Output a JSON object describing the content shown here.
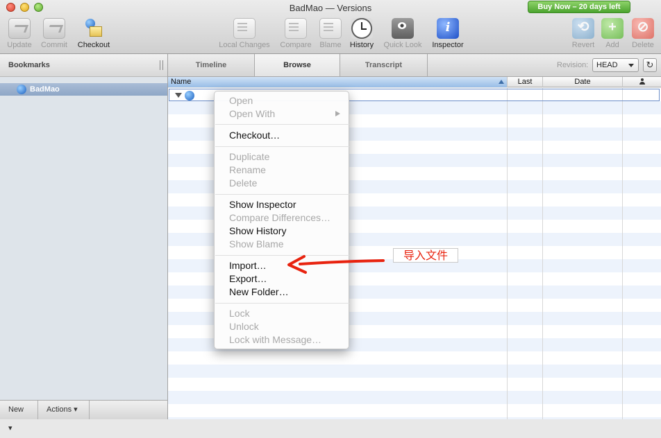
{
  "window": {
    "title": "BadMao — Versions",
    "buy_now": "Buy Now – 20 days left"
  },
  "toolbar": {
    "update": "Update",
    "commit": "Commit",
    "checkout": "Checkout",
    "local_changes": "Local Changes",
    "compare": "Compare",
    "blame": "Blame",
    "history": "History",
    "quick_look": "Quick Look",
    "inspector": "Inspector",
    "revert": "Revert",
    "add": "Add",
    "delete": "Delete"
  },
  "sidebar": {
    "header": "Bookmarks",
    "items": [
      {
        "label": "BadMao"
      }
    ],
    "footer": {
      "new_label": "New ▾",
      "actions_label": "Actions ▾"
    }
  },
  "tabs": [
    "Timeline",
    "Browse",
    "Transcript"
  ],
  "active_tab": "Browse",
  "revision": {
    "label": "Revision:",
    "value": "HEAD"
  },
  "columns": {
    "name": "Name",
    "last": "Last",
    "date": "Date"
  },
  "context_menu": {
    "open": "Open",
    "open_with": "Open With",
    "checkout": "Checkout…",
    "duplicate": "Duplicate",
    "rename": "Rename",
    "delete": "Delete",
    "show_inspector": "Show Inspector",
    "compare_differences": "Compare Differences…",
    "show_history": "Show History",
    "show_blame": "Show Blame",
    "import": "Import…",
    "export": "Export…",
    "new_folder": "New Folder…",
    "lock": "Lock",
    "unlock": "Unlock",
    "lock_with_message": "Lock with Message…"
  },
  "annotation": {
    "text": "导入文件",
    "color": "#e8230f"
  }
}
